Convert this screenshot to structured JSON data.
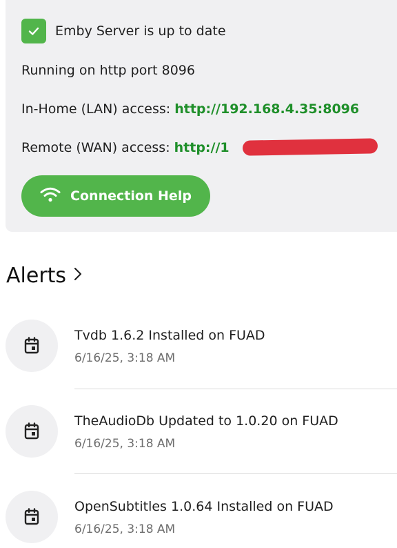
{
  "status": {
    "up_to_date": "Emby Server is up to date",
    "running": "Running on http port 8096",
    "lan_label": "In-Home (LAN) access: ",
    "lan_url": "http://192.168.4.35:8096",
    "wan_label": "Remote (WAN) access: ",
    "wan_url": "http://1",
    "button_label": "Connection Help"
  },
  "alerts": {
    "title": "Alerts",
    "items": [
      {
        "title": "Tvdb 1.6.2 Installed on FUAD",
        "time": "6/16/25, 3:18 AM"
      },
      {
        "title": "TheAudioDb Updated to 1.0.20 on FUAD",
        "time": "6/16/25, 3:18 AM"
      },
      {
        "title": "OpenSubtitles 1.0.64 Installed on FUAD",
        "time": "6/16/25, 3:18 AM"
      }
    ]
  },
  "colors": {
    "accent": "#52b54b",
    "link": "#1f8f2a",
    "redaction": "#e0313e"
  },
  "icons": {
    "check": "check-icon",
    "wifi": "wifi-icon",
    "chevron": "chevron-right-icon",
    "calendar": "calendar-icon"
  }
}
